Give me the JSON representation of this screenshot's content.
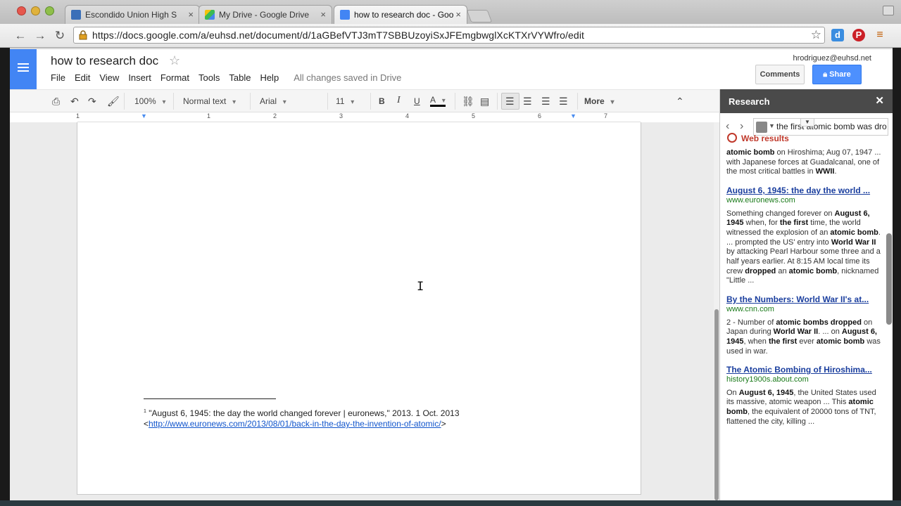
{
  "browser": {
    "tabs": [
      {
        "title": "Escondido Union High S",
        "active": false
      },
      {
        "title": "My Drive - Google Drive",
        "active": false
      },
      {
        "title": "how to research doc - Goo",
        "active": true
      }
    ],
    "url": "https://docs.google.com/a/euhsd.net/document/d/1aGBefVTJ3mT7SBBUzoyiSxJFEmgbwglXcKTXrVYWfro/edit",
    "extensions": [
      {
        "name": "docs-extension-icon",
        "label": "d",
        "color": "#3a8de0"
      },
      {
        "name": "pinterest-icon",
        "label": "P",
        "color": "#cb2027"
      }
    ]
  },
  "docs": {
    "title": "how to research doc",
    "user": "hrodriguez@euhsd.net",
    "menu": [
      "File",
      "Edit",
      "View",
      "Insert",
      "Format",
      "Tools",
      "Table",
      "Help"
    ],
    "save_status": "All changes saved in Drive",
    "comments_label": "Comments",
    "share_label": "Share",
    "toolbar": {
      "zoom": "100%",
      "style": "Normal text",
      "font": "Arial",
      "size": "11",
      "bold": "B",
      "italic": "I",
      "underline": "U",
      "text_color": "A",
      "more": "More"
    },
    "ruler_numbers": [
      "1",
      "1",
      "2",
      "3",
      "4",
      "5",
      "6",
      "7"
    ],
    "footnote": {
      "marker": "1",
      "text": " \"August 6, 1945: the day the world changed forever | euronews,\" 2013. 1 Oct. 2013",
      "link_prefix": "<",
      "link": "http://www.euronews.com/2013/08/01/back-in-the-day-the-invention-of-atomic/",
      "link_suffix": ">"
    }
  },
  "research": {
    "title": "Research",
    "query": "the first atomic bomb was dro",
    "section_label": "Web results",
    "results": [
      {
        "title": "",
        "url": "",
        "snippet_html": "<b>atomic bomb</b> on Hiroshima; Aug 07, 1947 ... with Japanese forces at Guadalcanal, one of the most critical battles in <b>WWII</b>."
      },
      {
        "title": "August 6, 1945: the day the world ...",
        "url": "www.euronews.com",
        "snippet_html": "Something changed forever on <b>August 6, 1945</b> when, for <b>the first</b> time, the world witnessed the explosion of an <b>atomic bomb</b>. ... prompted the US' entry into <b>World War II</b> by attacking Pearl Harbour some three and a half years earlier. At 8:15 AM local time its crew <b>dropped</b> an <b>atomic bomb</b>, nicknamed \"Little ..."
      },
      {
        "title": "By the Numbers: World War II's at...",
        "url": "www.cnn.com",
        "snippet_html": "2 - Number of <b>atomic bombs dropped</b> on Japan during <b>World War II</b>. ... on <b>August 6, 1945</b>, when <b>the first</b> ever <b>atomic bomb</b> was used in war."
      },
      {
        "title": "The Atomic Bombing of Hiroshima...",
        "url": "history1900s.about.com",
        "snippet_html": "On <b>August 6, 1945</b>, the United States used its massive, atomic weapon ... This <b>atomic bomb</b>, the equivalent of 20000 tons of TNT, flattened the city, killing ..."
      }
    ]
  }
}
